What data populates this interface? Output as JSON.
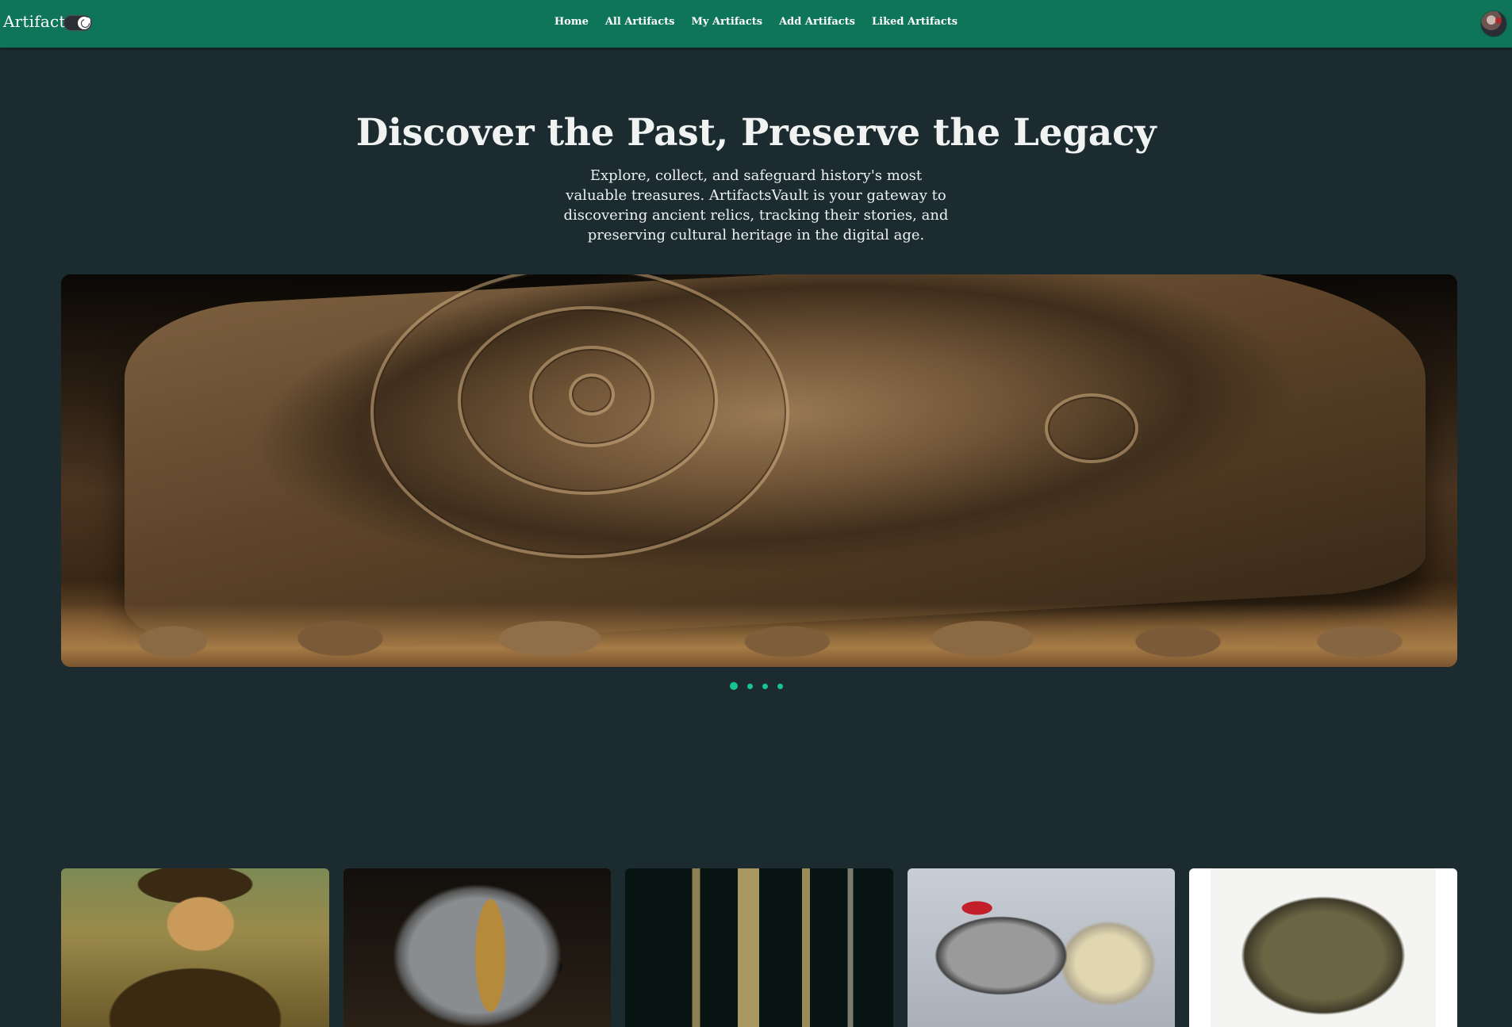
{
  "nav": {
    "brand": "Artifacts",
    "links": [
      "Home",
      "All Artifacts",
      "My Artifacts",
      "Add Artifacts",
      "Liked Artifacts"
    ],
    "theme_toggle_icon": "moon-icon",
    "accent_color": "#0f7559"
  },
  "hero": {
    "title": "Discover the Past, Preserve the Legacy",
    "description": "Explore, collect, and safeguard history's most valuable treasures. ArtifactsVault is your gateway to discovering ancient relics, tracking their stories, and preserving cultural heritage in the digital age."
  },
  "slider": {
    "slide_count": 4,
    "active_index": 0,
    "dot_color": "#17c48f"
  },
  "colors": {
    "page_background": "#1b2b2f",
    "navbar": "#0f7559"
  }
}
